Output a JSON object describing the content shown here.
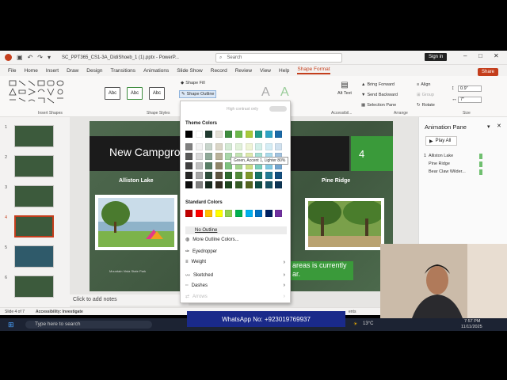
{
  "window": {
    "filename": "SC_PPT365_CS1-3A_DidiShoeb_1 (1).pptx - PowerP...",
    "search_placeholder": "Search",
    "signin_label": "Sign in"
  },
  "menu": [
    "File",
    "Home",
    "Insert",
    "Draw",
    "Design",
    "Transitions",
    "Animations",
    "Slide Show",
    "Record",
    "Review",
    "View",
    "Help",
    "Shape Format"
  ],
  "share_label": "Share",
  "ribbon": {
    "insert_shapes_label": "Insert Shapes",
    "shape_styles_label": "Shape Styles",
    "style_sample": "Abc",
    "shape_fill": "Shape Fill",
    "shape_outline": "Shape Outline",
    "high_contrast": "High contrast only",
    "alt_text": "Alt Text",
    "accessibility": "Accessibil...",
    "bring_forward": "Bring Forward",
    "send_backward": "Send Backward",
    "selection_pane": "Selection Pane",
    "align": "Align",
    "group": "Group",
    "rotate": "Rotate",
    "arrange_label": "Arrange",
    "height": "0.9\"",
    "width": "7\"",
    "size_label": "Size"
  },
  "dropdown": {
    "theme_colors_label": "Theme Colors",
    "standard_colors_label": "Standard Colors",
    "tooltip": "Green, Accent 1, Lighter 80%",
    "no_outline": "No Outline",
    "more_colors": "More Outline Colors...",
    "eyedropper": "Eyedropper",
    "weight": "Weight",
    "sketched": "Sketched",
    "dashes": "Dashes",
    "arrows": "Arrows",
    "theme_top": [
      "#000000",
      "#ffffff",
      "#1f3a2f",
      "#e3e0d6",
      "#3e8c3e",
      "#6bb84b",
      "#a8c93a",
      "#1f9a8a",
      "#2ea3c4",
      "#1a6aa8"
    ],
    "theme_shades": [
      [
        "#7f7f7f",
        "#f2f2f2",
        "#c7d4cb",
        "#dad6c7",
        "#d4ead4",
        "#e1f1d9",
        "#eef4d6",
        "#d2efe9",
        "#d5edf5",
        "#d0e1ef"
      ],
      [
        "#595959",
        "#d9d9d9",
        "#8fa998",
        "#b9b29a",
        "#a9d6a9",
        "#c3e3b3",
        "#dde9ad",
        "#a5dfd3",
        "#abdbeb",
        "#a2c3df"
      ],
      [
        "#3f3f3f",
        "#bfbfbf",
        "#587d65",
        "#8e8568",
        "#7ec27e",
        "#a5d58d",
        "#cbdf84",
        "#78cfbd",
        "#82c9e2",
        "#73a5cf"
      ],
      [
        "#262626",
        "#a6a6a6",
        "#2d4d3a",
        "#5c5540",
        "#2e692e",
        "#508a38",
        "#7e972b",
        "#177367",
        "#227a93",
        "#134f7e"
      ],
      [
        "#0d0d0d",
        "#808080",
        "#172a1f",
        "#302c21",
        "#1f461f",
        "#355c25",
        "#546520",
        "#0f4d45",
        "#175262",
        "#0d3554"
      ]
    ],
    "standard": [
      "#c00000",
      "#ff0000",
      "#ffc000",
      "#ffff00",
      "#92d050",
      "#00b050",
      "#00b0f0",
      "#0070c0",
      "#002060",
      "#7030a0"
    ]
  },
  "slide": {
    "title": "New Campgro",
    "number": "4",
    "left_caption": "Alliston Lake",
    "right_caption": "Pine Ridge",
    "photo_caption": "Mountain Vista State Park",
    "text_box": "areas is currently ar."
  },
  "thumbnails": [
    "1",
    "2",
    "3",
    "4",
    "5",
    "6"
  ],
  "notes": "Click to add notes",
  "status": {
    "slide_of": "Slide 4 of 7",
    "accessibility": "Accessibility: Investigate",
    "comments": "ents"
  },
  "animation_pane": {
    "title": "Animation Pane",
    "play_all": "Play All",
    "items": [
      "Alliston Lake",
      "Pine Ridge",
      "Bear Claw Wilder..."
    ],
    "item_number": "1"
  },
  "taskbar": {
    "search": "Type here to search",
    "temp": "13°C",
    "time": "7:57 PM",
    "date": "11/11/2025"
  },
  "watermark": "WhatsApp No: +923019769937"
}
